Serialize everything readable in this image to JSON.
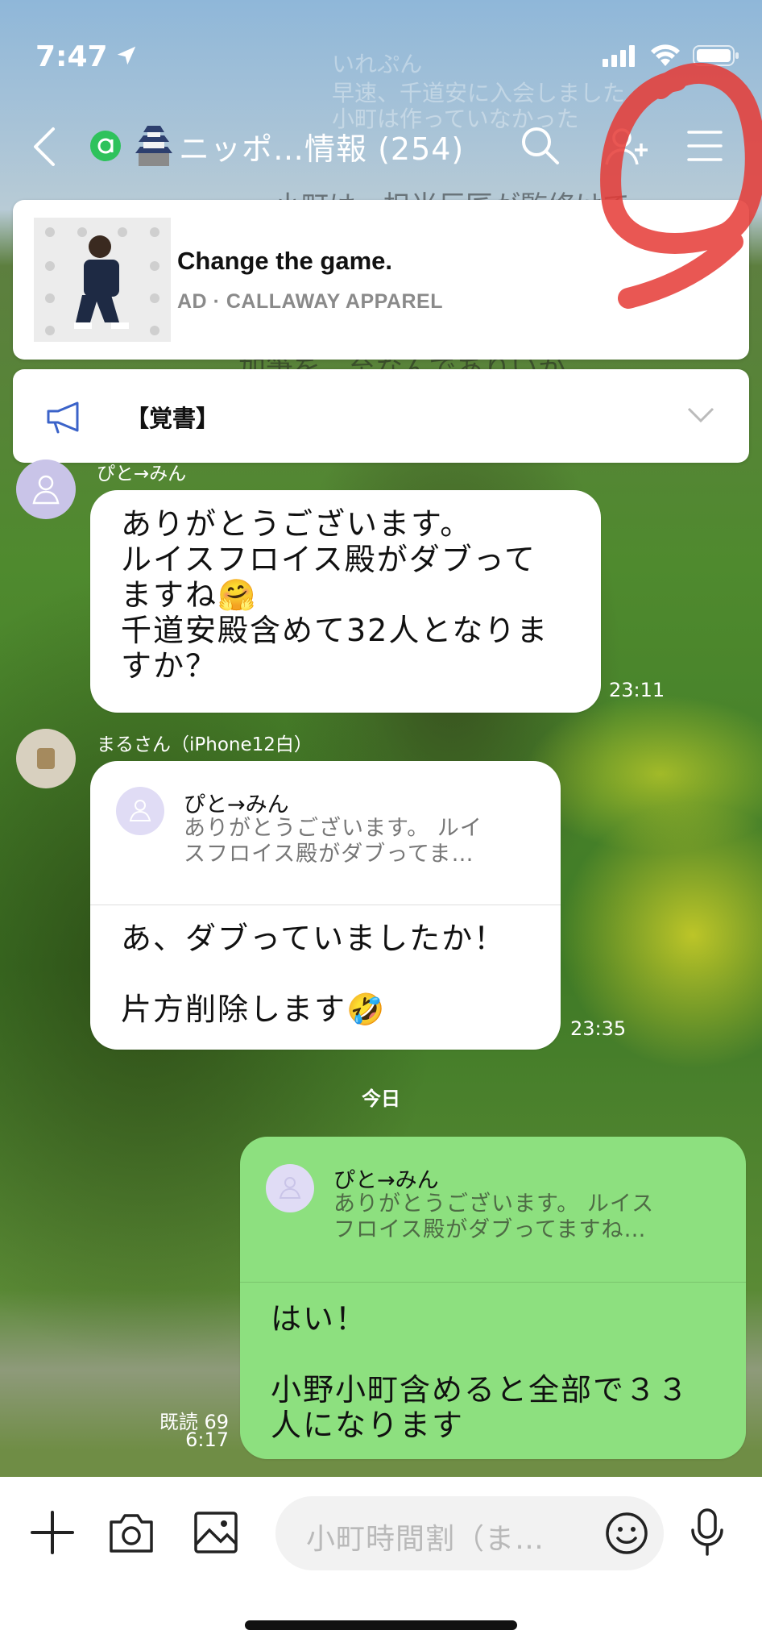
{
  "status": {
    "time": "7:47"
  },
  "header": {
    "title": "ニッポ…情報 (254)",
    "bg_sender": "いれぷん",
    "bg_preview_1": "早速、千道安に入会しました",
    "bg_preview_2": "小町は作っていなかった",
    "bg_preview_3": "小町は…担当巨匠が監修けで",
    "bg_preview_4": "加筆を…至なんでありいか"
  },
  "ad": {
    "title": "Change the game.",
    "label": "AD",
    "advertiser": "CALLAWAY APPAREL"
  },
  "notice": {
    "text": "【覚書】"
  },
  "messages": [
    {
      "sender": "ぴと→みん",
      "text": "ありがとうございます。\nルイスフロイス殿がダブって\nますね🤗\n千道安殿含めて32人となりま\nすか？",
      "time": "23:11"
    },
    {
      "sender": "まるさん（iPhone12白）",
      "quote_name": "ぴと→みん",
      "quote_text": "ありがとうございます。 ルイ\nスフロイス殿がダブってま…",
      "text": "あ、ダブっていましたか！\n\n片方削除します🤣",
      "time": "23:35"
    }
  ],
  "date_separator": "今日",
  "my_message": {
    "quote_name": "ぴと→みん",
    "quote_text": "ありがとうございます。 ルイス\nフロイス殿がダブってますね…",
    "text": "はい！\n\n小野小町含めると全部で３３\n人になります",
    "read": "既読 69",
    "time": "6:17"
  },
  "input": {
    "placeholder": "小町時間割（ま…"
  },
  "colors": {
    "my_bubble": "#8de07f",
    "annotation": "#e53935",
    "line_green": "#2ec25c"
  }
}
